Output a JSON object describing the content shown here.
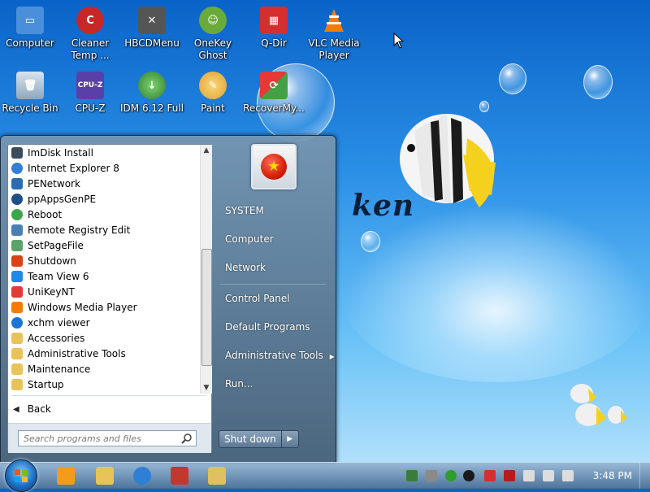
{
  "desktop": {
    "brand_text": "ken",
    "icons": [
      {
        "label": "Computer",
        "icon": "computer-icon",
        "color": "#4a8fd9"
      },
      {
        "label": "Cleaner Temp ...",
        "icon": "cleaner-icon",
        "color": "#c62828"
      },
      {
        "label": "HBCDMenu",
        "icon": "tools-icon",
        "color": "#555555"
      },
      {
        "label": "OneKey Ghost",
        "icon": "ghost-icon",
        "color": "#6aaa3a"
      },
      {
        "label": "Q-Dir",
        "icon": "qdir-icon",
        "color": "#d32f2f"
      },
      {
        "label": "VLC Media Player",
        "icon": "vlc-icon",
        "color": "#f57c00"
      },
      {
        "label": "Recycle Bin",
        "icon": "recycle-bin-icon",
        "color": "#9ab3c8"
      },
      {
        "label": "CPU-Z",
        "icon": "cpuz-icon",
        "color": "#5b3fa8"
      },
      {
        "label": "IDM 6.12 Full",
        "icon": "idm-icon",
        "color": "#2e7d32"
      },
      {
        "label": "Paint",
        "icon": "paint-icon",
        "color": "#e0a030"
      },
      {
        "label": "RecoverMy...",
        "icon": "recover-icon",
        "color": "#3f51b5"
      }
    ]
  },
  "start_menu": {
    "programs": [
      {
        "label": "ImDisk Install",
        "color": "#3b4b5c"
      },
      {
        "label": "Internet Explorer 8",
        "color": "#2f7fd6"
      },
      {
        "label": "PENetwork",
        "color": "#2b6cb0"
      },
      {
        "label": "ppAppsGenPE",
        "color": "#1c4f8a"
      },
      {
        "label": "Reboot",
        "color": "#3aa84a"
      },
      {
        "label": "Remote Registry Edit",
        "color": "#4a7fb5"
      },
      {
        "label": "SetPageFile",
        "color": "#5aa36a"
      },
      {
        "label": "Shutdown",
        "color": "#d84315"
      },
      {
        "label": "Team View 6",
        "color": "#1e88e5"
      },
      {
        "label": "UniKeyNT",
        "color": "#e53935"
      },
      {
        "label": "Windows Media Player",
        "color": "#f57c00"
      },
      {
        "label": "xchm viewer",
        "color": "#1976d2"
      },
      {
        "label": "Accessories",
        "color": "#e8c35a"
      },
      {
        "label": "Administrative Tools",
        "color": "#e8c35a"
      },
      {
        "label": "Maintenance",
        "color": "#e8c35a"
      },
      {
        "label": "Startup",
        "color": "#e8c35a"
      }
    ],
    "back_label": "Back",
    "search_placeholder": "Search programs and files",
    "right_items": [
      {
        "label": "SYSTEM"
      },
      {
        "label": "Computer"
      },
      {
        "label": "Network"
      },
      {
        "label": "Control Panel"
      },
      {
        "label": "Default Programs"
      },
      {
        "label": "Administrative Tools",
        "submenu": true
      },
      {
        "label": "Run..."
      }
    ],
    "shutdown_label": "Shut down"
  },
  "taskbar": {
    "pinned": [
      {
        "name": "media-player-taskbar-icon",
        "color": "#f59b1c"
      },
      {
        "name": "explorer-taskbar-icon",
        "color": "#e8c35a"
      },
      {
        "name": "internet-explorer-taskbar-icon",
        "color": "#2f7fd6"
      },
      {
        "name": "network-taskbar-icon",
        "color": "#c0392b"
      },
      {
        "name": "paint-taskbar-icon",
        "color": "#e0c060"
      }
    ],
    "tray_icons": [
      {
        "name": "network-tray-icon",
        "color": "#3a7d3a"
      },
      {
        "name": "drive-tray-icon",
        "color": "#8a8a8a"
      },
      {
        "name": "check-tray-icon",
        "color": "#2e9e2e"
      },
      {
        "name": "play-tray-icon",
        "color": "#1a1a1a"
      },
      {
        "name": "unikey-tray-icon",
        "color": "#d32f2f"
      },
      {
        "name": "security-tray-icon",
        "color": "#b71c1c"
      },
      {
        "name": "flag-tray-icon",
        "color": "#dddddd"
      },
      {
        "name": "display-tray-icon",
        "color": "#dddddd"
      },
      {
        "name": "volume-muted-tray-icon",
        "color": "#dddddd"
      }
    ],
    "clock": "3:48 PM"
  }
}
